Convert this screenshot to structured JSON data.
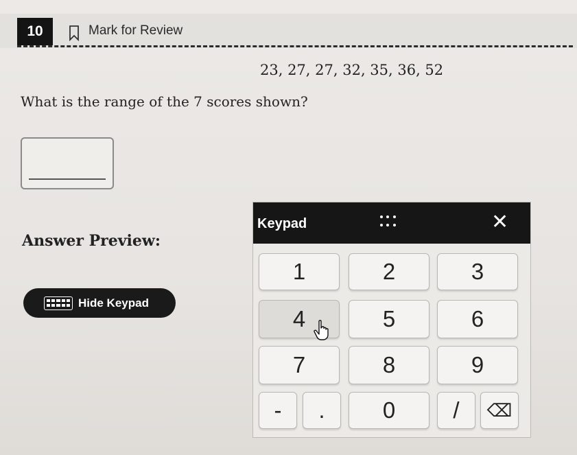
{
  "question": {
    "number": "10",
    "mark_for_review": "Mark for Review",
    "scores": "23, 27, 27, 32, 35, 36, 52",
    "prompt": "What is the range of the 7 scores shown?",
    "answer_value": "",
    "answer_preview_label": "Answer Preview:"
  },
  "controls": {
    "hide_keypad_label": "Hide Keypad",
    "keyboard_icon": "keyboard-icon"
  },
  "keypad": {
    "title": "Keypad",
    "close_symbol": "✕",
    "keys": {
      "k1": "1",
      "k2": "2",
      "k3": "3",
      "k4": "4",
      "k5": "5",
      "k6": "6",
      "k7": "7",
      "k8": "8",
      "k9": "9",
      "minus": "-",
      "dot": ".",
      "k0": "0",
      "slash": "/",
      "backspace": "⌫"
    }
  },
  "colors": {
    "dark": "#161616",
    "background": "#ebe8e5",
    "key_face": "#f4f3f1"
  }
}
